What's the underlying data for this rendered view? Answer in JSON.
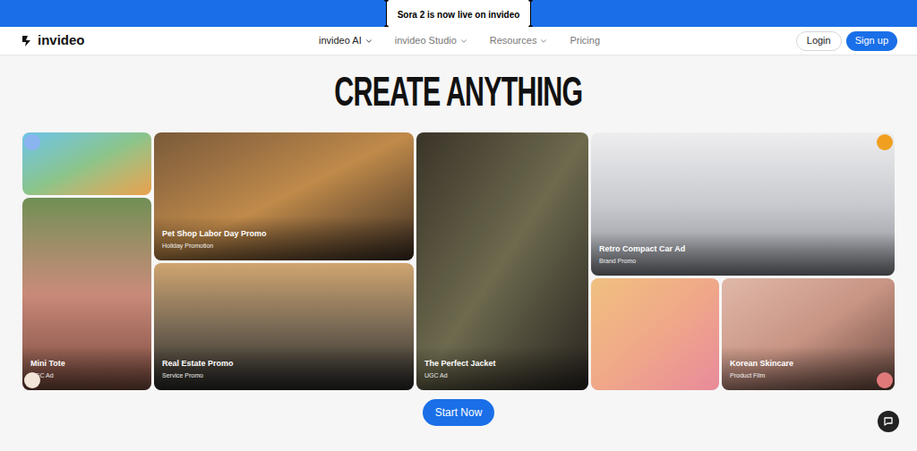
{
  "banner": {
    "text": "Sora 2 is now live on invideo"
  },
  "logo": {
    "text": "invideo"
  },
  "nav": [
    {
      "label": "invideo AI",
      "dropdown": true,
      "selected": true
    },
    {
      "label": "invideo Studio",
      "dropdown": true,
      "selected": false
    },
    {
      "label": "Resources",
      "dropdown": true,
      "selected": false
    },
    {
      "label": "Pricing",
      "dropdown": false,
      "selected": false
    }
  ],
  "auth": {
    "login": "Login",
    "signup": "Sign up"
  },
  "hero": {
    "title": "CREATE ANYTHING"
  },
  "cards": [
    {
      "title": "Mini Tote",
      "tag": "UGC Ad"
    },
    {
      "title": "Pet Shop Labor Day Promo",
      "tag": "Holiday Promotion"
    },
    {
      "title": "Real Estate Promo",
      "tag": "Service Promo"
    },
    {
      "title": "The Perfect Jacket",
      "tag": "UGC Ad"
    },
    {
      "title": "Retro Compact Car Ad",
      "tag": "Brand Promo"
    },
    {
      "title": "Korean Skincare",
      "tag": "Product Film"
    }
  ],
  "cta": {
    "label": "Start Now"
  }
}
